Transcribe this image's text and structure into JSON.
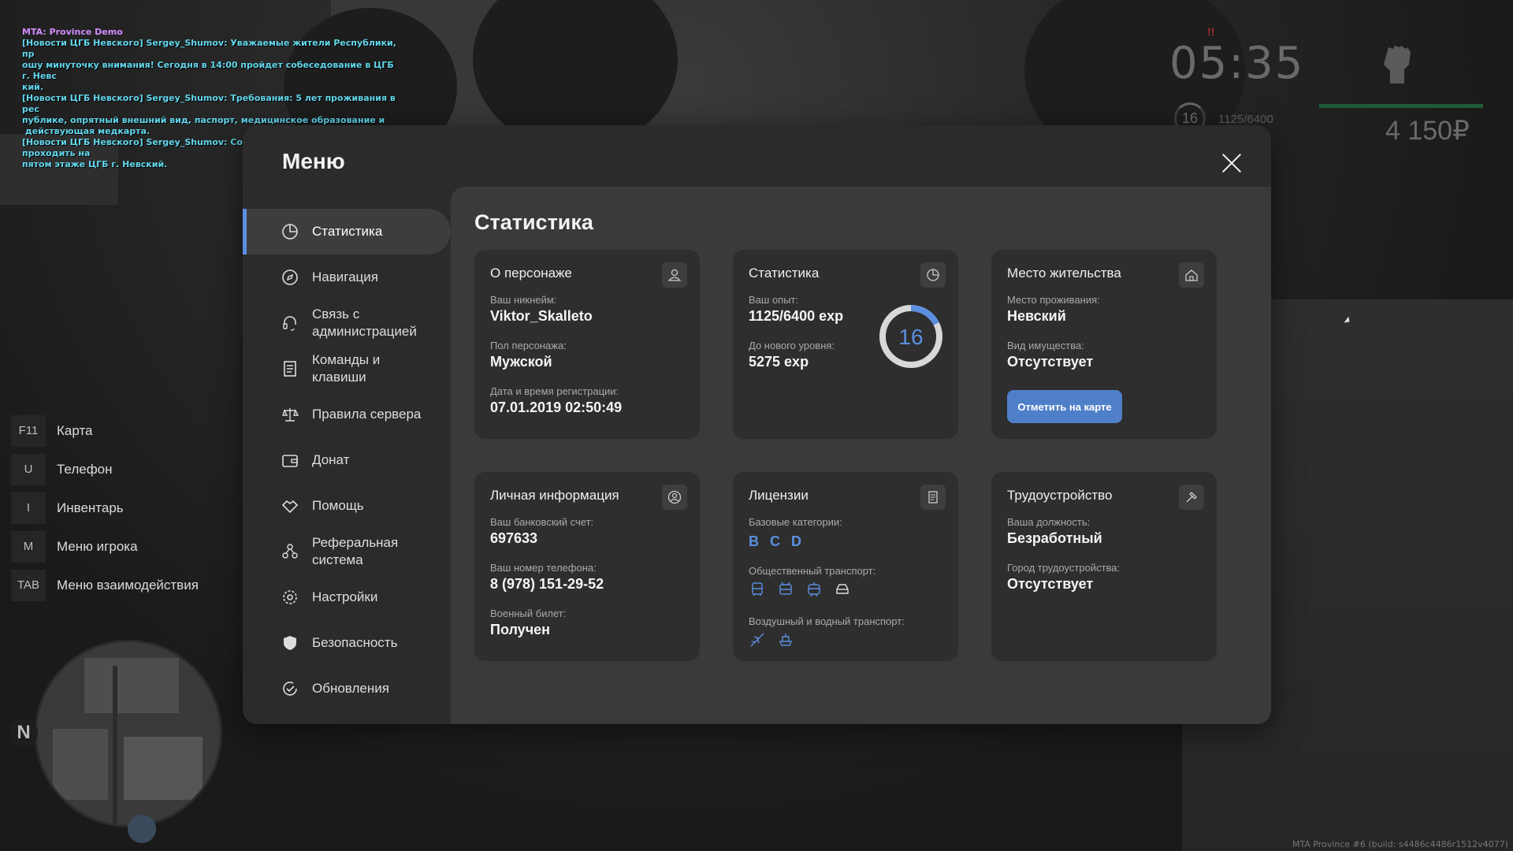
{
  "chat": {
    "title": "MTA: Province Demo",
    "lines": [
      "[Новости ЦГБ Невского] Sergey_Shumov: Уважаемые жители Республики, пр",
      "ошу минуточку внимания! Сегодня в 14:00 пройдет собеседование в ЦГБ г. Невс",
      "кий.",
      "[Новости ЦГБ Невского] Sergey_Shumov: Требования: 5 лет проживания в рес",
      "публике, опрятный внешний вид, паспорт, медицинское образование и",
      " действующая медкарта.",
      "[Новости ЦГБ Невского] Sergey_Shumov: Собеседование будет проходить на",
      "пятом этаже ЦГБ г. Невский."
    ]
  },
  "hud": {
    "alert": "!!",
    "time": "05:35",
    "level": "16",
    "exp": "1125/6400",
    "money": "4 150₽",
    "health_fraction": 1.0,
    "colors": {
      "health": "#1f5b39"
    }
  },
  "hotkeys": [
    {
      "key": "F11",
      "label": "Карта"
    },
    {
      "key": "U",
      "label": "Телефон"
    },
    {
      "key": "I",
      "label": "Инвентарь"
    },
    {
      "key": "M",
      "label": "Меню игрока"
    },
    {
      "key": "TAB",
      "label": "Меню взаимодействия"
    }
  ],
  "minimap": {
    "north": "N"
  },
  "build_info": "MTA Province #6 (build: s4486c4486r1512v4077)",
  "menu": {
    "title": "Меню",
    "accent": "#5b8fe0",
    "sidebar": [
      {
        "icon": "pie-chart-icon",
        "label": "Статистика",
        "active": true
      },
      {
        "icon": "compass-icon",
        "label": "Навигация"
      },
      {
        "icon": "headset-icon",
        "label": "Связь с\nадминистрацией"
      },
      {
        "icon": "document-icon",
        "label": "Команды и\nклавиши"
      },
      {
        "icon": "scales-icon",
        "label": "Правила сервера"
      },
      {
        "icon": "wallet-icon",
        "label": "Донат"
      },
      {
        "icon": "handshake-icon",
        "label": "Помощь"
      },
      {
        "icon": "referral-icon",
        "label": "Реферальная\nсистема"
      },
      {
        "icon": "gear-icon",
        "label": "Настройки"
      },
      {
        "icon": "shield-icon",
        "label": "Безопасность"
      },
      {
        "icon": "refresh-check-icon",
        "label": "Обновления"
      }
    ],
    "content_title": "Статистика",
    "cards": {
      "character": {
        "title": "О персонаже",
        "nick_label": "Ваш никнейм:",
        "nick": "Viktor_Skalleto",
        "gender_label": "Пол персонажа:",
        "gender": "Мужской",
        "reg_label": "Дата и время регистрации:",
        "reg": "07.01.2019 02:50:49"
      },
      "stats": {
        "title": "Статистика",
        "exp_label": "Ваш опыт:",
        "exp": "1125/6400 exp",
        "next_label": "До нового уровня:",
        "next": "5275 exp",
        "level": "16",
        "progress": 0.176
      },
      "residence": {
        "title": "Место жительства",
        "place_label": "Место проживания:",
        "place": "Невский",
        "property_label": "Вид имущества:",
        "property": "Отсутствует",
        "button": "Отметить на карте"
      },
      "personal": {
        "title": "Личная информация",
        "bank_label": "Ваш банковский счет:",
        "bank": "697633",
        "phone_label": "Ваш номер телефона:",
        "phone": "8 (978) 151-29-52",
        "military_label": "Военный билет:",
        "military": "Получен"
      },
      "licenses": {
        "title": "Лицензии",
        "base_label": "Базовые категории:",
        "base": [
          "B",
          "C",
          "D"
        ],
        "public_label": "Общественный транспорт:",
        "public_icons": [
          "bus-icon",
          "trolleybus-icon",
          "tram-icon",
          "taxi-icon"
        ],
        "air_label": "Воздушный и водный транспорт:",
        "air_icons": [
          "plane-icon",
          "boat-icon"
        ]
      },
      "job": {
        "title": "Трудоустройство",
        "position_label": "Ваша должность:",
        "position": "Безработный",
        "city_label": "Город трудоустройства:",
        "city": "Отсутствует"
      }
    }
  }
}
